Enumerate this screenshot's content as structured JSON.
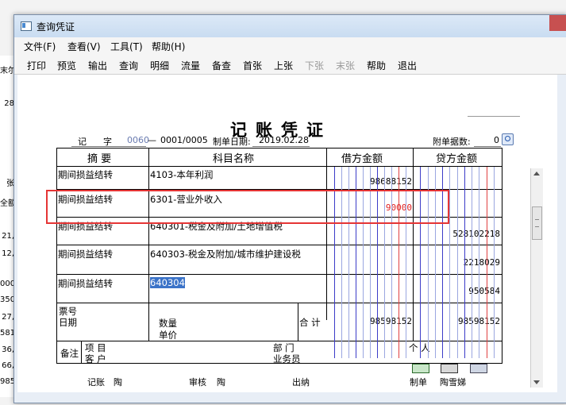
{
  "background": {
    "left_cells": [
      "末尔",
      "28",
      "张",
      "全额",
      "21,",
      "12,",
      "000,",
      "350,",
      "27,",
      "581,",
      "36,",
      "66,",
      "985,"
    ]
  },
  "window": {
    "title": "查询凭证"
  },
  "menu": [
    "文件(F)",
    "查看(V)",
    "工具(T)",
    "帮助(H)"
  ],
  "toolbar": [
    {
      "label": "打印",
      "enabled": true
    },
    {
      "label": "预览",
      "enabled": true
    },
    {
      "label": "输出",
      "enabled": true
    },
    {
      "label": "查询",
      "enabled": true
    },
    {
      "label": "明细",
      "enabled": true
    },
    {
      "label": "流量",
      "enabled": true
    },
    {
      "label": "备查",
      "enabled": true
    },
    {
      "label": "首张",
      "enabled": true
    },
    {
      "label": "上张",
      "enabled": true
    },
    {
      "label": "下张",
      "enabled": false
    },
    {
      "label": "末张",
      "enabled": false
    },
    {
      "label": "帮助",
      "enabled": true
    },
    {
      "label": "退出",
      "enabled": true
    }
  ],
  "voucher": {
    "title": "记账凭证",
    "type_label": "记",
    "zi_label": "字",
    "number_prefix": "0060",
    "number_seq": "0001/0005",
    "date_label": "制单日期:",
    "date": "2019.02.28",
    "attachments_label": "附单据数:",
    "attachments": "0",
    "headers": {
      "summary": "摘 要",
      "account": "科目名称",
      "debit": "借方金额",
      "credit": "贷方金额"
    },
    "rows": [
      {
        "summary": "期间损益结转",
        "account": "4103-本年利润",
        "debit": "98688152",
        "credit": "",
        "debit_red": false
      },
      {
        "summary": "期间损益结转",
        "account": "6301-营业外收入",
        "debit": "90000",
        "credit": "",
        "debit_red": true
      },
      {
        "summary": "期间损益结转",
        "account": "640301-税金及附加/土地增值税",
        "debit": "",
        "credit": "528102218"
      },
      {
        "summary": "期间损益结转",
        "account": "640303-税金及附加/城市维护建设税",
        "debit": "",
        "credit": "2218029"
      },
      {
        "summary": "期间损益结转",
        "account": "640304",
        "debit": "",
        "credit": "950584",
        "selected": true
      }
    ],
    "footer": {
      "ticket_label": "票号",
      "date_label": "日期",
      "qty_label": "数量",
      "price_label": "单价",
      "total_label": "合 计",
      "total_debit": "98598152",
      "total_credit": "98598152",
      "remark_label": "备注",
      "project_label": "项  目",
      "customer_label": "客  户",
      "dept_label": "部  门",
      "person_label": "个  人",
      "salesman_label": "业务员"
    },
    "signatures": {
      "bookkeeper_label": "记账",
      "bookkeeper": "陶",
      "reviewer_label": "审核",
      "reviewer": "陶",
      "cashier_label": "出纳",
      "maker_label": "制单",
      "maker": "陶雪娣"
    }
  }
}
